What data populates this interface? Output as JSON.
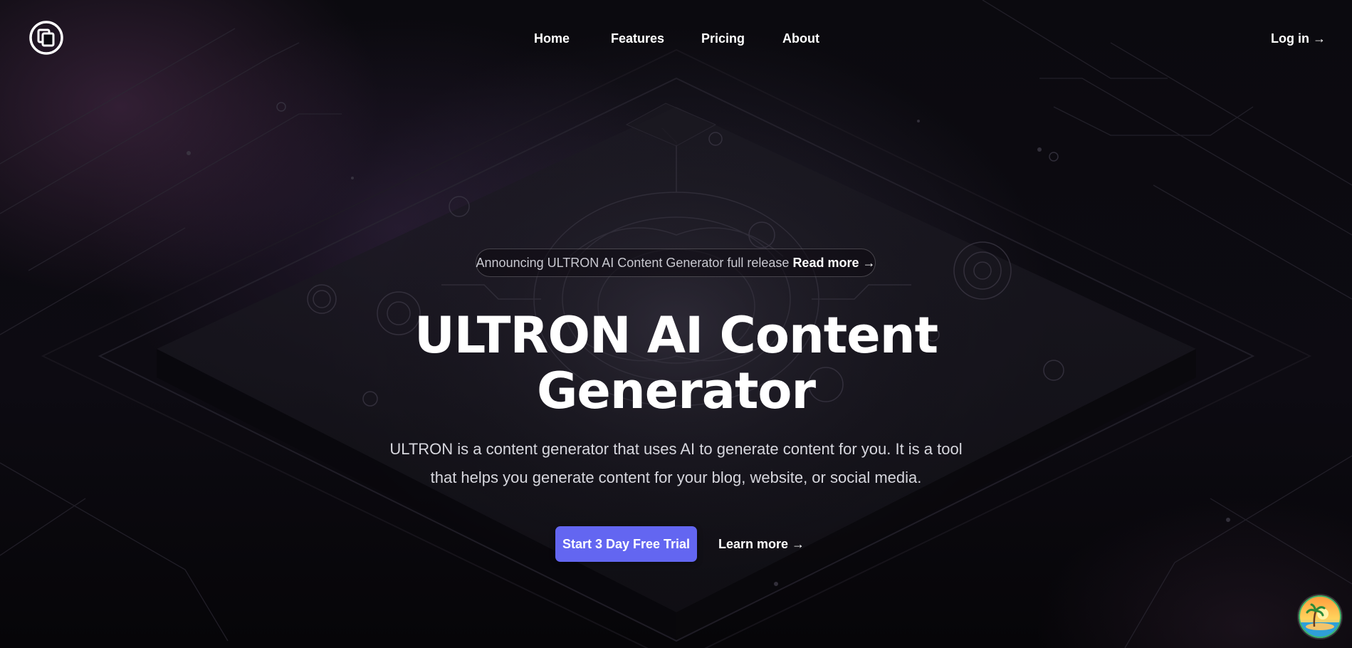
{
  "nav": {
    "logo_icon": "squares-logo-icon",
    "items": [
      {
        "label": "Home"
      },
      {
        "label": "Features"
      },
      {
        "label": "Pricing"
      },
      {
        "label": "About"
      }
    ],
    "login_label": "Log in →"
  },
  "hero": {
    "announcement_text": "Announcing ULTRON AI Content Generator full release",
    "announcement_link": "Read more →",
    "title_line1": "ULTRON AI Content",
    "title_line2": "Generator",
    "description_line1": "ULTRON is a content generator that uses AI to generate content for you. It is a tool",
    "description_line2": "that helps you generate content for your blog, website, or social media.",
    "primary_cta": "Start 3 Day Free Trial",
    "secondary_cta": "Learn more →"
  },
  "colors": {
    "accent": "#6366f1",
    "background": "#0b0a0f",
    "text": "#ffffff"
  },
  "widgets": {
    "avatar_icon": "beach-avatar-icon"
  }
}
